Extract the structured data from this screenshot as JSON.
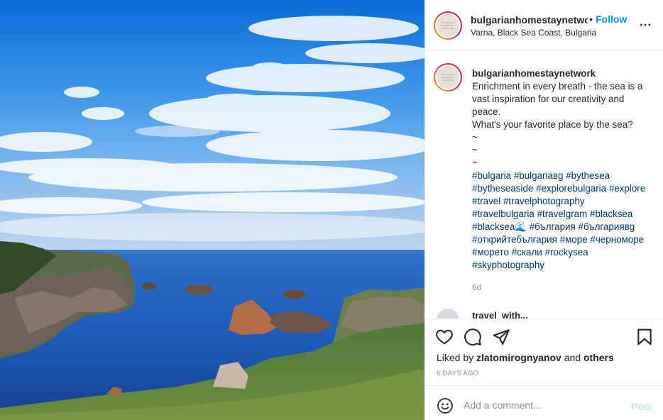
{
  "post": {
    "image_alt": "rocky coastline by the sea under a blue sky with clouds",
    "header": {
      "avatar_text": "BULGARIAN HOMESTAY NETWORK",
      "username": "bulgarianhomestaynetwo",
      "dot": "•",
      "follow_label": "Follow",
      "location": "Varna, Black Sea Coast, Bulgaria",
      "more_icon": "more-horizontal-icon"
    },
    "caption": {
      "username": "bulgarianhomestaynetwork",
      "lines": [
        "Enrichment in every breath - the sea is a vast inspiration for our creativity and peace.",
        "What's your favorite place by the sea?",
        "~",
        "~",
        "~"
      ],
      "hashtags": [
        "#bulgaria",
        "#bulgariaвg",
        "#bythesea",
        "#bytheseaside",
        "#explorebulgaria",
        "#explore",
        "#travel",
        "#travelphotography",
        "#travelbulgaria",
        "#travelgram",
        "#blacksea",
        "#blacksea🌊",
        "#българия",
        "#българиявg",
        "#открийтебългария",
        "#море",
        "#черноморе",
        "#морето",
        "#скали",
        "#rockysea",
        "#skyphotography"
      ],
      "age": "6d"
    },
    "next_comment": {
      "username": "travel_with..."
    },
    "actions": {
      "like_icon": "heart-icon",
      "comment_icon": "comment-bubble-icon",
      "share_icon": "paper-plane-icon",
      "save_icon": "bookmark-icon"
    },
    "likes": {
      "prefix": "Liked by ",
      "user": "zlatomirognyanov",
      "middle": " and ",
      "others": "others"
    },
    "timestamp": "6 DAYS AGO",
    "add_comment": {
      "placeholder": "Add a comment...",
      "post_label": "Post",
      "emoji_icon": "smiley-face-icon"
    },
    "colors": {
      "accent": "#0095f6",
      "hashtag": "#00376b",
      "muted": "#8e8e8e",
      "post_disabled": "#b2dffc"
    }
  }
}
